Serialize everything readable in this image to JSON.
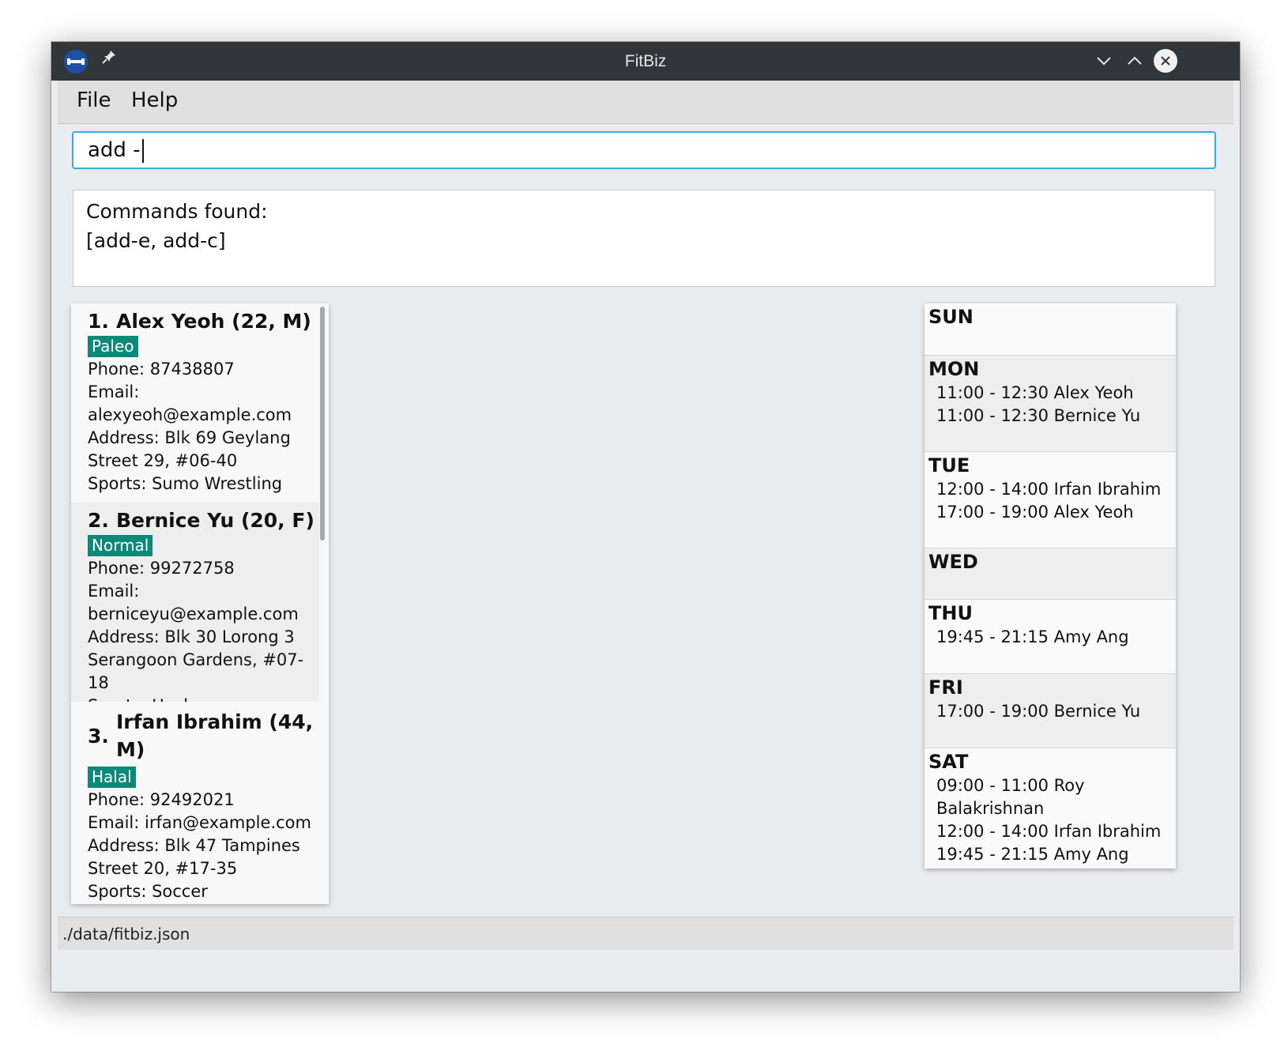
{
  "window": {
    "title": "FitBiz"
  },
  "menu": {
    "file": "File",
    "help": "Help"
  },
  "command": {
    "value": "add -"
  },
  "result": {
    "line1": "Commands found:",
    "line2": "[add-e, add-c]"
  },
  "clients": [
    {
      "index": "1.",
      "name": "Alex Yeoh (22, M)",
      "tag": "Paleo",
      "phone": "Phone: 87438807",
      "email_label": "Email:",
      "email": "alexyeoh@example.com",
      "address1": "Address: Blk 69 Geylang",
      "address2": "Street 29, #06-40",
      "sports": "Sports: Sumo Wrestling"
    },
    {
      "index": "2.",
      "name": "Bernice Yu (20, F)",
      "tag": "Normal",
      "phone": "Phone: 99272758",
      "email_label": "Email:",
      "email": "berniceyu@example.com",
      "address1": "Address: Blk 30 Lorong 3",
      "address2": "Serangoon Gardens, #07-18",
      "sports": "Sports: Hockey"
    },
    {
      "index": "3.",
      "name_line1": "Irfan Ibrahim (44,",
      "name_line2": "M)",
      "tag": "Halal",
      "phone": "Phone: 92492021",
      "email": "Email: irfan@example.com",
      "address1": "Address: Blk 47 Tampines",
      "address2": "Street 20, #17-35",
      "sports": "Sports: Soccer"
    }
  ],
  "schedule": {
    "sun": {
      "name": "SUN",
      "slots": []
    },
    "mon": {
      "name": "MON",
      "slots": [
        "11:00 - 12:30 Alex Yeoh",
        "11:00 - 12:30 Bernice Yu"
      ]
    },
    "tue": {
      "name": "TUE",
      "slots": [
        "12:00 - 14:00 Irfan Ibrahim",
        "17:00 - 19:00 Alex Yeoh"
      ]
    },
    "wed": {
      "name": "WED",
      "slots": []
    },
    "thu": {
      "name": "THU",
      "slots": [
        "19:45 - 21:15 Amy Ang"
      ]
    },
    "fri": {
      "name": "FRI",
      "slots": [
        "17:00 - 19:00 Bernice Yu"
      ]
    },
    "sat": {
      "name": "SAT",
      "slots": [
        "09:00 - 11:00 Roy Balakrishnan",
        "12:00 - 14:00 Irfan Ibrahim",
        "19:45 - 21:15 Amy Ang"
      ]
    }
  },
  "status": {
    "path": "./data/fitbiz.json"
  },
  "colors": {
    "titlebar": "#31363b",
    "accent": "#39a9e8",
    "tag": "#0b8a7a"
  }
}
